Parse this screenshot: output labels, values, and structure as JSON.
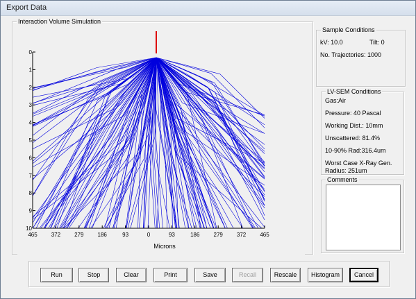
{
  "window": {
    "title": "Export Data"
  },
  "simulation_group": {
    "legend": "Interaction Volume Simulation"
  },
  "sample_group": {
    "legend": "Sample Conditions",
    "kv": "kV:  10.0",
    "tilt": "Tilt: 0",
    "trajectories": "No. Trajectories: 1000"
  },
  "lvsem_group": {
    "legend": "LV-SEM Conditions",
    "gas": "Gas:Air",
    "pressure": "Pressure:  40 Pascal",
    "working_dist": "Working Dist.:  10mm",
    "unscattered": "Unscattered: 81.4%",
    "rad": "10-90% Rad:316.4um",
    "worst_case_1": "Worst Case X-Ray Gen.",
    "worst_case_2": "Radius: 251um"
  },
  "comments_group": {
    "legend": "Comments",
    "value": ""
  },
  "plot": {
    "y_ticks": [
      "0",
      "1",
      "2",
      "3",
      "4",
      "5",
      "6",
      "7",
      "8",
      "9",
      "10"
    ],
    "x_ticks": [
      "465",
      "372",
      "279",
      "186",
      "93",
      "0",
      "93",
      "186",
      "279",
      "372",
      "465"
    ],
    "x_label": "Microns",
    "line_color": "#0000dd",
    "beam_color": "#dd0000"
  },
  "buttons": {
    "run": "Run",
    "stop": "Stop",
    "clear": "Clear",
    "print": "Print",
    "save": "Save",
    "recall": "Recall",
    "rescale": "Rescale",
    "histogram": "Histogram",
    "cancel": "Cancel"
  }
}
